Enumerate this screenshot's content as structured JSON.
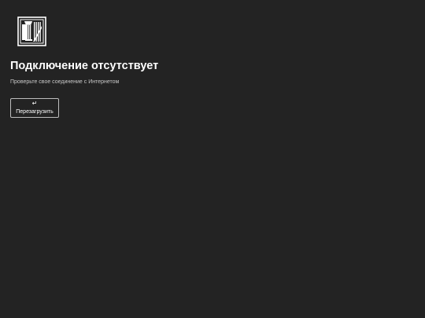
{
  "icons": {
    "logo": "site-logo-icon",
    "reload": "return-arrow-icon"
  },
  "error": {
    "title": "Подключение отсутствует",
    "message": "Проверьте свое соединение с Интернетом",
    "reload_icon": "↵",
    "reload_label": "Перезагрузить"
  },
  "colors": {
    "background": "#232323",
    "text": "#ffffff",
    "muted_text": "#c8c8c8",
    "button_border": "#bdbdbd"
  }
}
